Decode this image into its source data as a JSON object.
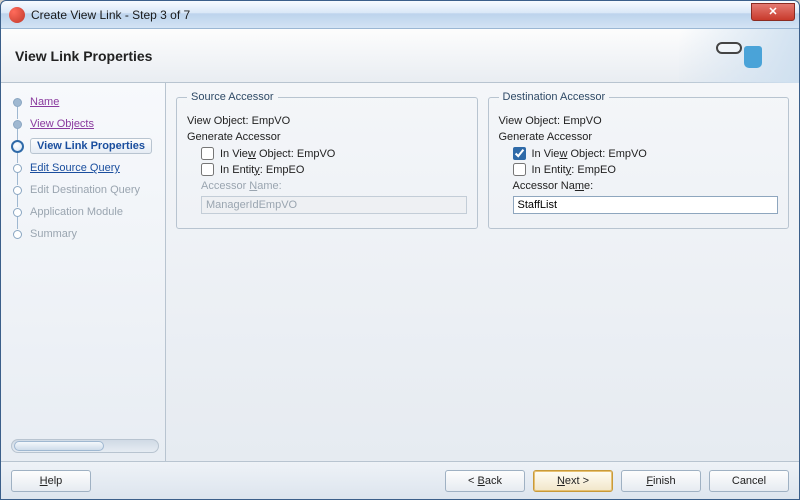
{
  "window": {
    "title": "Create View Link - Step 3 of 7"
  },
  "header": {
    "title": "View Link Properties"
  },
  "steps": {
    "name": "Name",
    "viewObjects": "View Objects",
    "viewLinkProps": "View Link Properties",
    "editSourceQuery": "Edit Source Query",
    "editDestQuery": "Edit Destination Query",
    "appModule": "Application Module",
    "summary": "Summary"
  },
  "source": {
    "legend": "Source Accessor",
    "viewObjectLabel": "View Object:",
    "viewObjectValue": "EmpVO",
    "generateLabel": "Generate Accessor",
    "inViewObject_pre": "In Vie",
    "inViewObject_u": "w",
    "inViewObject_post": " Object: EmpVO",
    "inViewObject_checked": false,
    "inEntity_pre": "In Entit",
    "inEntity_u": "y",
    "inEntity_post": ": EmpEO",
    "inEntity_checked": false,
    "accessorNameLabel_pre": "Accessor ",
    "accessorNameLabel_u": "N",
    "accessorNameLabel_post": "ame:",
    "accessorNameValue": "ManagerIdEmpVO"
  },
  "dest": {
    "legend": "Destination Accessor",
    "viewObjectLabel": "View Object:",
    "viewObjectValue": "EmpVO",
    "generateLabel": "Generate Accessor",
    "inViewObject_pre": "In Vie",
    "inViewObject_u": "w",
    "inViewObject_post": " Object: EmpVO",
    "inViewObject_checked": true,
    "inEntity_pre": "In Entit",
    "inEntity_u": "y",
    "inEntity_post": ": EmpEO",
    "inEntity_checked": false,
    "accessorNameLabel_pre": "Accessor Na",
    "accessorNameLabel_u": "m",
    "accessorNameLabel_post": "e:",
    "accessorNameValue": "StaffList"
  },
  "footer": {
    "help_u": "H",
    "help_post": "elp",
    "back_pre": "< ",
    "back_u": "B",
    "back_post": "ack",
    "next_u": "N",
    "next_post": "ext >",
    "finish_u": "F",
    "finish_post": "inish",
    "cancel": "Cancel"
  }
}
